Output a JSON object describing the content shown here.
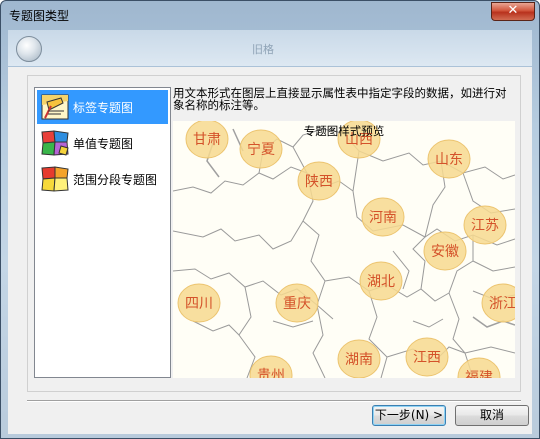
{
  "window": {
    "title": "专题图类型",
    "close_label": "✕"
  },
  "header": {
    "watermark_text": "旧格"
  },
  "list": {
    "items": [
      {
        "label": "标签专题图",
        "selected": true,
        "icon": "label-thematic-icon"
      },
      {
        "label": "单值专题图",
        "selected": false,
        "icon": "unique-value-thematic-icon"
      },
      {
        "label": "范围分段专题图",
        "selected": false,
        "icon": "range-thematic-icon"
      }
    ]
  },
  "description": "用文本形式在图层上直接显示属性表中指定字段的数据，如进行对象名称的标注等。",
  "preview": {
    "title": "专题图样式预览",
    "labels": [
      "甘肃",
      "宁夏",
      "山西",
      "山东",
      "陕西",
      "河南",
      "江苏",
      "安徽",
      "湖北",
      "四川",
      "重庆",
      "浙江",
      "湖南",
      "江西",
      "贵州",
      "福建"
    ]
  },
  "buttons": {
    "next": "下一步(N) >",
    "cancel": "取消"
  },
  "colors": {
    "selection": "#3399ff",
    "label_bubble": "#f7d98f",
    "label_text": "#d4522a"
  }
}
